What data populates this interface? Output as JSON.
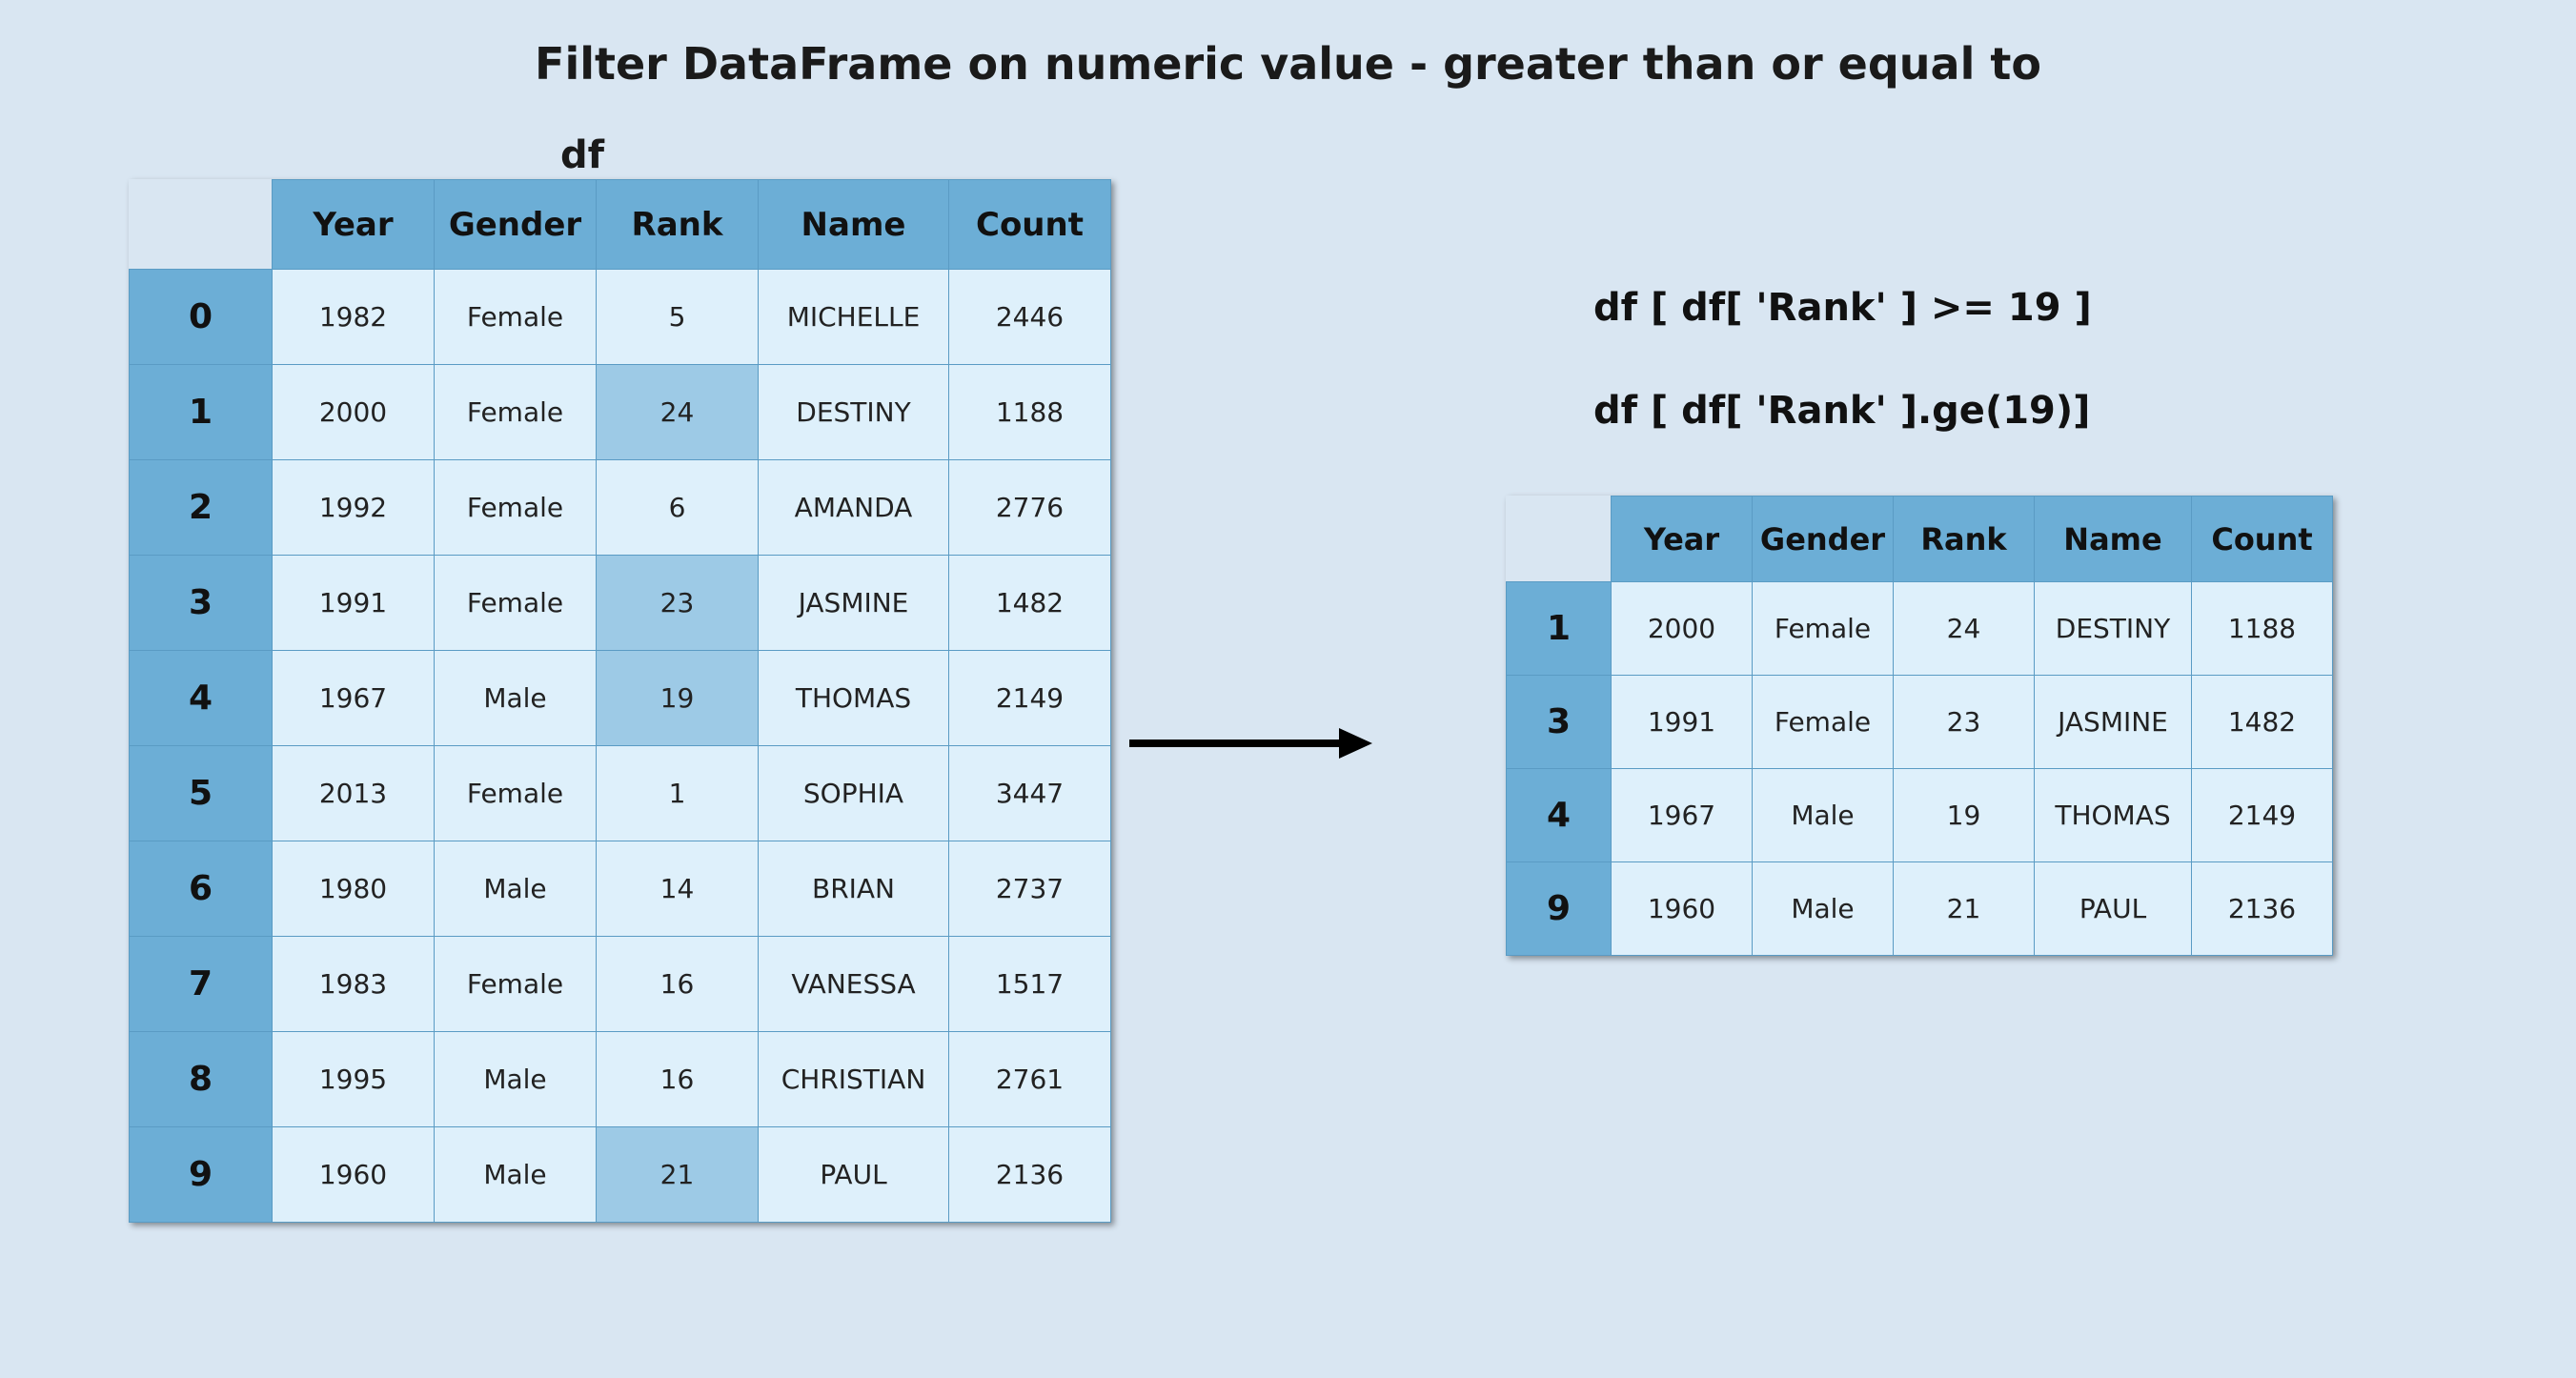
{
  "title": "Filter DataFrame on numeric value - greater than or equal to",
  "left_label": "df",
  "code": {
    "line1": "df [ df[ 'Rank' ] >= 19 ]",
    "line2": "df [ df[ 'Rank' ].ge(19)]"
  },
  "columns": [
    "Year",
    "Gender",
    "Rank",
    "Name",
    "Count"
  ],
  "left_rows": [
    {
      "idx": "0",
      "Year": "1982",
      "Gender": "Female",
      "Rank": "5",
      "Name": "MICHELLE",
      "Count": "2446",
      "hl": false
    },
    {
      "idx": "1",
      "Year": "2000",
      "Gender": "Female",
      "Rank": "24",
      "Name": "DESTINY",
      "Count": "1188",
      "hl": true
    },
    {
      "idx": "2",
      "Year": "1992",
      "Gender": "Female",
      "Rank": "6",
      "Name": "AMANDA",
      "Count": "2776",
      "hl": false
    },
    {
      "idx": "3",
      "Year": "1991",
      "Gender": "Female",
      "Rank": "23",
      "Name": "JASMINE",
      "Count": "1482",
      "hl": true
    },
    {
      "idx": "4",
      "Year": "1967",
      "Gender": "Male",
      "Rank": "19",
      "Name": "THOMAS",
      "Count": "2149",
      "hl": true
    },
    {
      "idx": "5",
      "Year": "2013",
      "Gender": "Female",
      "Rank": "1",
      "Name": "SOPHIA",
      "Count": "3447",
      "hl": false
    },
    {
      "idx": "6",
      "Year": "1980",
      "Gender": "Male",
      "Rank": "14",
      "Name": "BRIAN",
      "Count": "2737",
      "hl": false
    },
    {
      "idx": "7",
      "Year": "1983",
      "Gender": "Female",
      "Rank": "16",
      "Name": "VANESSA",
      "Count": "1517",
      "hl": false
    },
    {
      "idx": "8",
      "Year": "1995",
      "Gender": "Male",
      "Rank": "16",
      "Name": "CHRISTIAN",
      "Count": "2761",
      "hl": false
    },
    {
      "idx": "9",
      "Year": "1960",
      "Gender": "Male",
      "Rank": "21",
      "Name": "PAUL",
      "Count": "2136",
      "hl": true
    }
  ],
  "right_rows": [
    {
      "idx": "1",
      "Year": "2000",
      "Gender": "Female",
      "Rank": "24",
      "Name": "DESTINY",
      "Count": "1188"
    },
    {
      "idx": "3",
      "Year": "1991",
      "Gender": "Female",
      "Rank": "23",
      "Name": "JASMINE",
      "Count": "1482"
    },
    {
      "idx": "4",
      "Year": "1967",
      "Gender": "Male",
      "Rank": "19",
      "Name": "THOMAS",
      "Count": "2149"
    },
    {
      "idx": "9",
      "Year": "1960",
      "Gender": "Male",
      "Rank": "21",
      "Name": "PAUL",
      "Count": "2136"
    }
  ]
}
